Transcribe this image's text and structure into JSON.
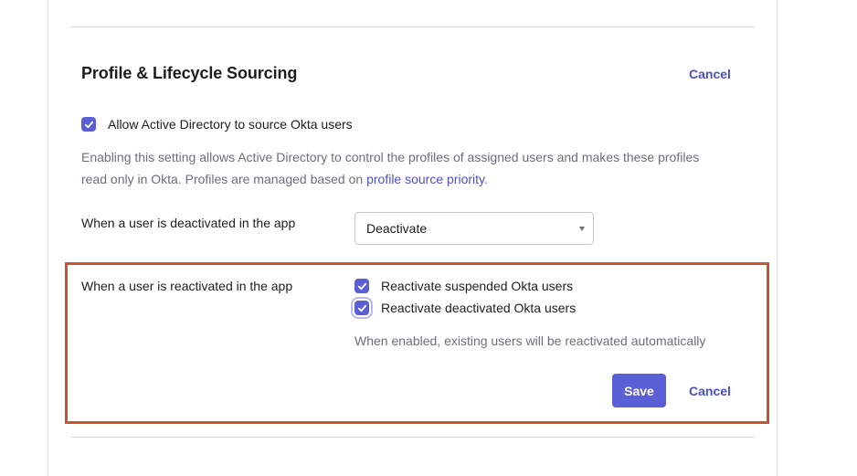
{
  "section": {
    "title": "Profile & Lifecycle Sourcing",
    "cancel_top": "Cancel"
  },
  "source_setting": {
    "checkbox_label": "Allow Active Directory to source Okta users",
    "checked": true,
    "description_prefix": "Enabling this setting allows Active Directory to control the profiles of assigned users and makes these profiles read only in Okta. Profiles are managed based on ",
    "description_link": "profile source priority",
    "description_suffix": "."
  },
  "deactivation": {
    "label": "When a user is deactivated in the app",
    "selected_value": "Deactivate"
  },
  "reactivation": {
    "label": "When a user is reactivated in the app",
    "options": [
      {
        "label": "Reactivate suspended Okta users",
        "checked": true
      },
      {
        "label": "Reactivate deactivated Okta users",
        "checked": true
      }
    ],
    "help_text": "When enabled, existing users will be reactivated automatically"
  },
  "actions": {
    "save_label": "Save",
    "cancel_label": "Cancel"
  },
  "colors": {
    "accent": "#5b5fd6",
    "link": "#4b4fc7",
    "highlight_border": "#c9552a"
  },
  "icons": {
    "checkbox": "check-icon",
    "select": "caret-down-icon"
  }
}
